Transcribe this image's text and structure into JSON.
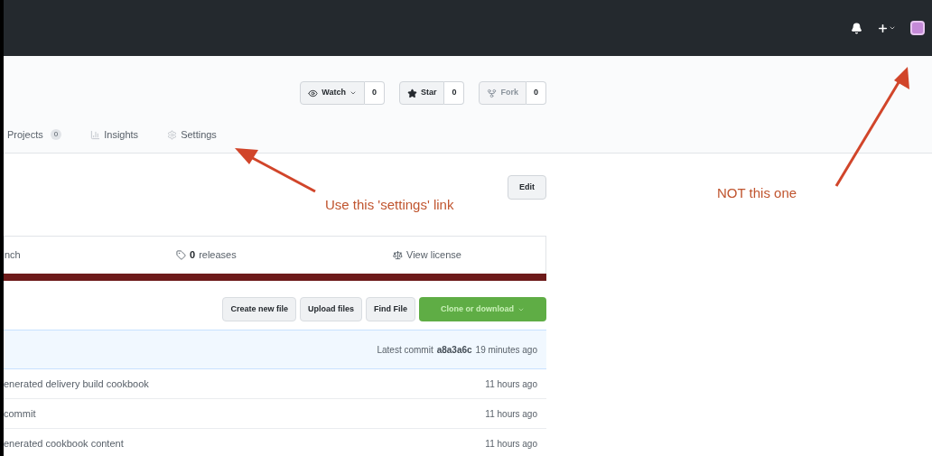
{
  "repo_actions": [
    {
      "label": "Watch",
      "count": "0",
      "disabled": false,
      "kind": "watch"
    },
    {
      "label": "Star",
      "count": "0",
      "disabled": false,
      "kind": "star"
    },
    {
      "label": "Fork",
      "count": "0",
      "disabled": true,
      "kind": "fork"
    }
  ],
  "tabs": [
    {
      "label": "Projects",
      "count": "0",
      "kind": "projects",
      "selected": false
    },
    {
      "label": "Insights",
      "kind": "insights",
      "selected": false
    },
    {
      "label": "Settings",
      "kind": "settings",
      "selected": false
    }
  ],
  "edit_button": "Edit",
  "summary": [
    {
      "label": "nch",
      "kind": "branch"
    },
    {
      "label": "releases",
      "count": "0",
      "kind": "releases"
    },
    {
      "label": "View license",
      "kind": "license"
    }
  ],
  "file_buttons": [
    {
      "label": "Create new file",
      "kind": "plain"
    },
    {
      "label": "Upload files",
      "kind": "plain"
    },
    {
      "label": "Find File",
      "kind": "plain"
    },
    {
      "label": "Clone or download",
      "kind": "primary"
    }
  ],
  "latest_commit": {
    "label": "Latest commit",
    "hash": "a8a3a6c",
    "time": "19 minutes ago"
  },
  "files": [
    {
      "message": "enerated delivery build cookbook",
      "age": "11 hours ago"
    },
    {
      "message": "commit",
      "age": "11 hours ago"
    },
    {
      "message": "enerated cookbook content",
      "age": "11 hours ago"
    }
  ],
  "annotations": [
    {
      "text": "Use this 'settings' link"
    },
    {
      "text": "NOT this one"
    }
  ]
}
